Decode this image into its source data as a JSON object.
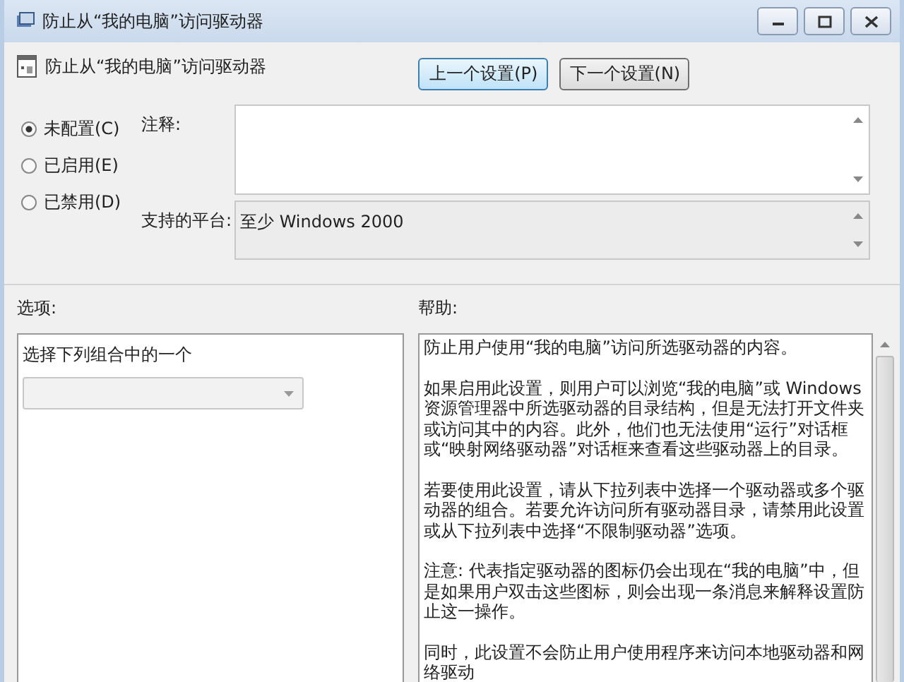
{
  "window": {
    "title": "防止从“我的电脑”访问驱动器"
  },
  "header": {
    "title": "防止从“我的电脑”访问驱动器"
  },
  "nav_buttons": [
    {
      "label": "上一个设置(P)",
      "selected": true
    },
    {
      "label": "下一个设置(N)",
      "selected": false
    }
  ],
  "state_options": [
    {
      "label": "未配置(C)",
      "selected": true
    },
    {
      "label": "已启用(E)",
      "selected": false
    },
    {
      "label": "已禁用(D)",
      "selected": false
    }
  ],
  "comment": {
    "label": "注释:"
  },
  "platform": {
    "label": "支持的平台:",
    "value": "至少 Windows 2000"
  },
  "options": {
    "label": "选项:",
    "prompt": "选择下列组合中的一个"
  },
  "help": {
    "label": "帮助:",
    "paragraphs": [
      "防止用户使用“我的电脑”访问所选驱动器的内容。",
      "如果启用此设置，则用户可以浏览“我的电脑”或 Windows 资源管理器中所选驱动器的目录结构，但是无法打开文件夹或访问其中的内容。此外，他们也无法使用“运行”对话框或“映射网络驱动器”对话框来查看这些驱动器上的目录。",
      "若要使用此设置，请从下拉列表中选择一个驱动器或多个驱动器的组合。若要允许访问所有驱动器目录，请禁用此设置或从下拉列表中选择“不限制驱动器”选项。",
      "注意: 代表指定驱动器的图标仍会出现在“我的电脑”中，但是如果用户双击这些图标，则会出现一条消息来解释设置防止这一操作。",
      "同时，此设置不会防止用户使用程序来访问本地驱动器和网络驱动"
    ]
  }
}
